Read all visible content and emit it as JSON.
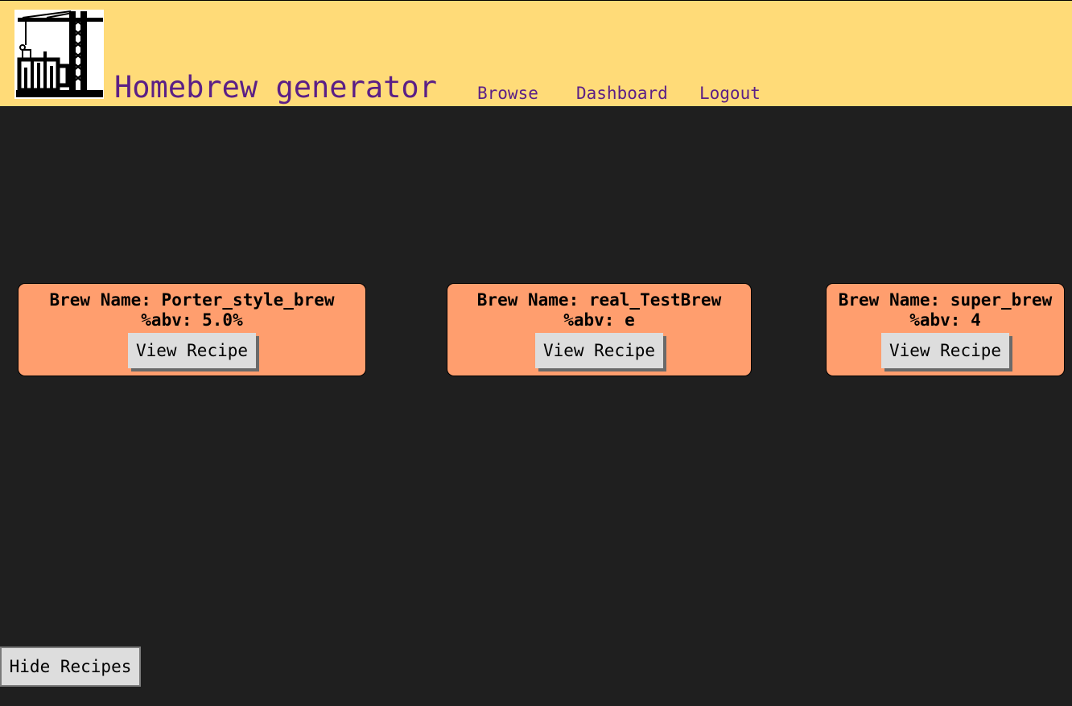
{
  "header": {
    "title": "Homebrew generator",
    "logo_icon": "brewery-crane-icon",
    "nav": {
      "browse": "Browse",
      "dashboard": "Dashboard",
      "logout": "Logout"
    }
  },
  "recipes": [
    {
      "name_line": "Brew Name: Porter_style_brew",
      "abv_line": "%abv: 5.0%",
      "button": "View Recipe"
    },
    {
      "name_line": "Brew Name: real_TestBrew",
      "abv_line": "%abv: e",
      "button": "View Recipe"
    },
    {
      "name_line": "Brew Name: super_brew",
      "abv_line": "%abv: 4",
      "button": "View Recipe"
    }
  ],
  "footer": {
    "hide_button": "Hide Recipes"
  },
  "colors": {
    "header_bg": "#ffdb78",
    "page_bg": "#1f1f1f",
    "accent_text": "#5b1f86",
    "card_bg": "#ff9e6e",
    "button_bg": "#dddddd"
  }
}
